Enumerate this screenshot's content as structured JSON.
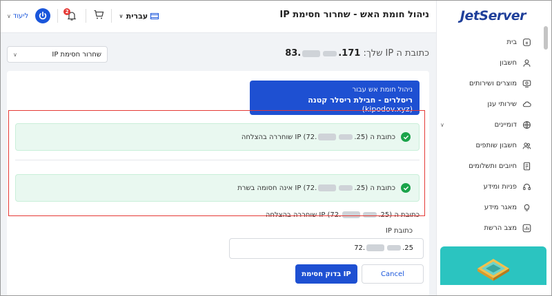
{
  "header": {
    "title": "ניהול חומת האש - שחרור חסימת IP",
    "logout_label": "ליעוד",
    "notifications_count": "2",
    "language_label": "עברית"
  },
  "sidebar": {
    "logo": "JetServer",
    "items": [
      {
        "label": "בית",
        "icon": "home-icon"
      },
      {
        "label": "חשבון",
        "icon": "user-icon"
      },
      {
        "label": "מוצרים ושירותים",
        "icon": "monitor-icon"
      },
      {
        "label": "שירותי ענן",
        "icon": "cloud-icon"
      },
      {
        "label": "דומיינים",
        "icon": "globe-icon"
      },
      {
        "label": "חשבון שותפים",
        "icon": "users-icon"
      },
      {
        "label": "חיובים ותשלומים",
        "icon": "invoice-icon"
      },
      {
        "label": "פניות ומידע",
        "icon": "headset-icon"
      },
      {
        "label": "מאגר מידע",
        "icon": "bulb-icon"
      },
      {
        "label": "מצב הרשת",
        "icon": "chart-icon"
      }
    ]
  },
  "main": {
    "ip_prefix": "כתובת ה IP שלך:",
    "ip_start": "83.",
    "ip_end": ".171",
    "select_value": "שחרור חסימת IP",
    "banner_line1": "ניהול חומת אש עבור",
    "banner_line2_bold": "ריסלרים - חבילת ריסלר קטנה",
    "banner_line2_domain": "(kipodov.xyz)",
    "alert1": "כתובת ה IP (72.",
    "alert1_mid": ".25) שוחררה בהצלחה",
    "alert2": "כתובת ה IP (72.",
    "alert2_mid": ".25) אינה חסומה בשרת",
    "plain_line": "כתובת ה IP (72.",
    "plain_line_mid": ".25) שוחררה בהצלחה",
    "field_label": "כתובת IP",
    "input_start": "72.",
    "input_end": ".25",
    "cancel_label": "Cancel",
    "check_label": "בדוק חסימת IP"
  }
}
